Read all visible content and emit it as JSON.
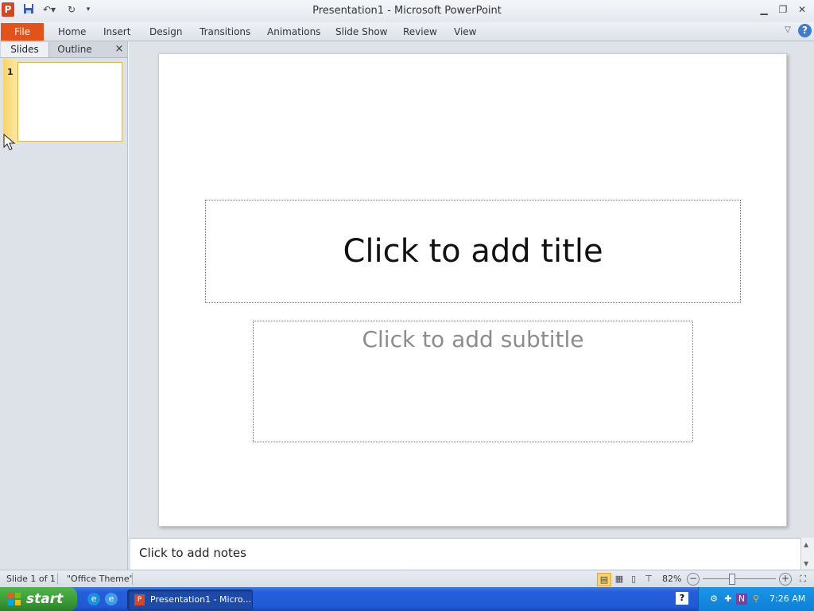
{
  "window": {
    "title": "Presentation1  -  Microsoft PowerPoint",
    "app_icon": "P"
  },
  "quick_access": {
    "save_icon": "save-icon",
    "undo_icon": "undo-icon",
    "redo_icon": "redo-icon"
  },
  "ribbon": {
    "file_label": "File",
    "tabs": [
      "Home",
      "Insert",
      "Design",
      "Transitions",
      "Animations",
      "Slide Show",
      "Review",
      "View"
    ],
    "help_label": "?"
  },
  "left_pane": {
    "tab_slides": "Slides",
    "tab_outline": "Outline",
    "close": "×",
    "slide_number": "1"
  },
  "slide": {
    "title_placeholder": "Click to add title",
    "subtitle_placeholder": "Click to add subtitle"
  },
  "notes": {
    "placeholder": "Click to add notes"
  },
  "status": {
    "slide_info": "Slide 1 of 1",
    "theme": "\"Office Theme\"",
    "zoom": "82%"
  },
  "taskbar": {
    "start_label": "start",
    "task_label": "Presentation1 - Micro...",
    "clock": "7:26 AM"
  },
  "colors": {
    "file_tab": "#e2521a",
    "ppt_brand": "#d24726",
    "taskbar": "#245edb",
    "start_button": "#3a9a35"
  }
}
